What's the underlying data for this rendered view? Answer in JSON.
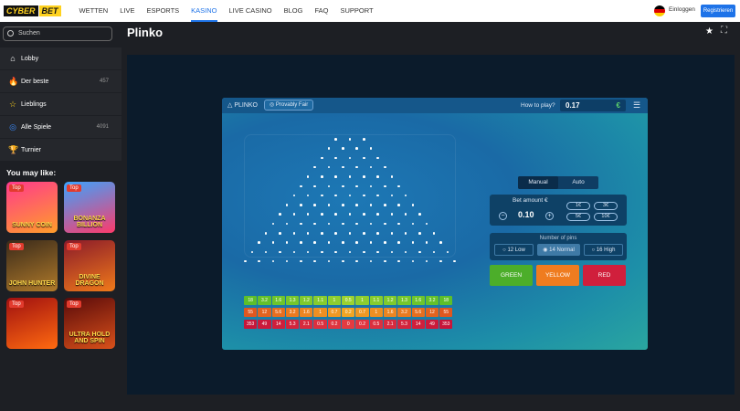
{
  "topbar": {
    "logo_a": "CYBER",
    "logo_b": "BET",
    "nav": [
      "WETTEN",
      "LIVE",
      "ESPORTS",
      "KASINO",
      "LIVE CASINO",
      "BLOG",
      "FAQ",
      "SUPPORT"
    ],
    "nav_active": "KASINO",
    "login": "Einloggen",
    "register": "Registrieren"
  },
  "sidebar": {
    "search_placeholder": "Suchen",
    "items": [
      {
        "label": "Lobby",
        "icon": "home-icon",
        "count": ""
      },
      {
        "label": "Der beste",
        "icon": "fire-icon",
        "count": "457"
      },
      {
        "label": "Lieblings",
        "icon": "star-icon",
        "count": ""
      },
      {
        "label": "Alle Spiele",
        "icon": "grid-icon",
        "count": "4091"
      },
      {
        "label": "Turnier",
        "icon": "trophy-icon",
        "count": ""
      }
    ],
    "you_may_like": "You may like:",
    "games": [
      {
        "badge": "Top",
        "name": "SUNNY COIN",
        "color1": "#ff3a8c",
        "color2": "#ff9d2a"
      },
      {
        "badge": "Top",
        "name": "BONANZA BILLION",
        "color1": "#3aa4ff",
        "color2": "#ff3a6a"
      },
      {
        "badge": "Top",
        "name": "JOHN HUNTER",
        "color1": "#3a2a1a",
        "color2": "#b07a2a"
      },
      {
        "badge": "Top",
        "name": "DIVINE DRAGON",
        "color1": "#8a1a2a",
        "color2": "#f07a1a"
      },
      {
        "badge": "Top",
        "name": "",
        "color1": "#a01010",
        "color2": "#ff6a10"
      },
      {
        "badge": "Top",
        "name": "ULTRA HOLD AND SPIN",
        "color1": "#5a0a0a",
        "color2": "#d8501a"
      }
    ]
  },
  "main": {
    "title": "Plinko"
  },
  "game": {
    "name": "PLINKO",
    "provably_fair": "Provably Fair",
    "how_to_play": "How to play?",
    "balance": "0.17",
    "currency": "€",
    "tabs": [
      "Manual",
      "Auto"
    ],
    "active_tab": "Manual",
    "bet_label": "Bet amount €",
    "bet_value": "0.10",
    "chips": [
      "1€",
      "3€",
      "5€",
      "10€"
    ],
    "pins_label": "Number of pins",
    "pins_options": [
      "12 Low",
      "14 Normal",
      "16 High"
    ],
    "pins_selected": "14 Normal",
    "buttons": [
      {
        "label": "GREEN",
        "color": "#4cae2a"
      },
      {
        "label": "YELLOW",
        "color": "#ef7c1f"
      },
      {
        "label": "RED",
        "color": "#d01f3c"
      }
    ],
    "multipliers": {
      "green": [
        "18",
        "3.2",
        "1.6",
        "1.3",
        "1.2",
        "1.1",
        "1",
        "0.5",
        "1",
        "1.1",
        "1.2",
        "1.3",
        "1.6",
        "3.2",
        "18"
      ],
      "yellow": [
        "55",
        "12",
        "5.6",
        "3.2",
        "1.6",
        "1",
        "0.7",
        "0.2",
        "0.7",
        "1",
        "1.6",
        "3.2",
        "5.6",
        "12",
        "55"
      ],
      "red": [
        "353",
        "49",
        "14",
        "5.3",
        "2.1",
        "0.5",
        "0.2",
        "0",
        "0.2",
        "0.5",
        "2.1",
        "5.3",
        "14",
        "49",
        "353"
      ]
    },
    "mult_colors": {
      "green": [
        "#5dbf2a",
        "#64c12b",
        "#6dc52c",
        "#76c72c",
        "#7fca2d",
        "#86cc2e",
        "#8dce2f",
        "#9bd230",
        "#8dce2f",
        "#86cc2e",
        "#7fca2d",
        "#76c72c",
        "#6dc52c",
        "#64c12b",
        "#5dbf2a"
      ],
      "yellow": [
        "#e0571f",
        "#e3631f",
        "#e66e20",
        "#e97a20",
        "#ec8521",
        "#ee8f22",
        "#f09823",
        "#f3a524",
        "#f09823",
        "#ee8f22",
        "#ec8521",
        "#e97a20",
        "#e66e20",
        "#e3631f",
        "#e0571f"
      ],
      "red": [
        "#c7153a",
        "#cb1a3b",
        "#cf1f3c",
        "#d3253d",
        "#d72a3e",
        "#db303f",
        "#df3540",
        "#e33b41",
        "#df3540",
        "#db303f",
        "#d72a3e",
        "#d3253d",
        "#cf1f3c",
        "#cb1a3b",
        "#c7153a"
      ]
    }
  }
}
